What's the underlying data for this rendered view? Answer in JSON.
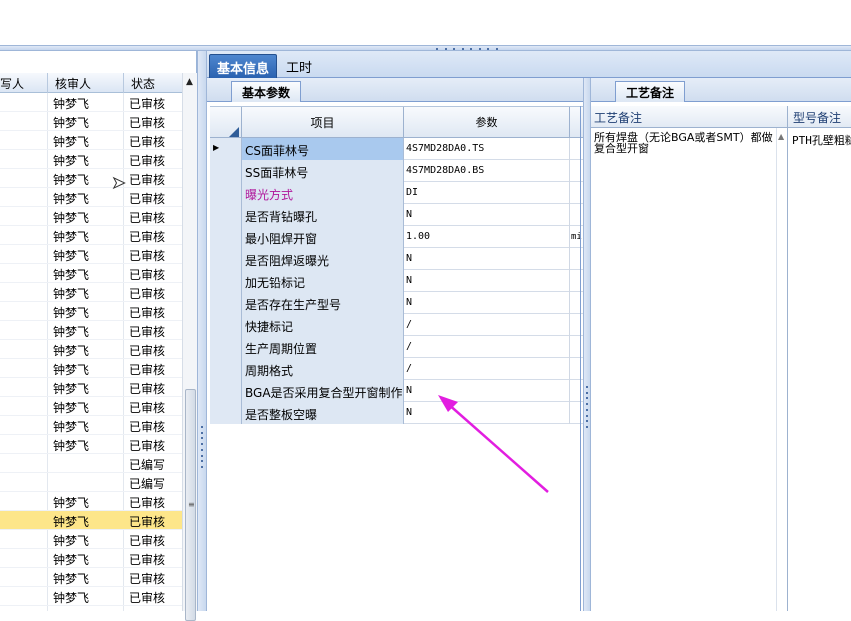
{
  "colors": {
    "accent": "#2a62b0",
    "selected_row": "#fde68a",
    "annotation_arrow": "#e21ee0"
  },
  "left_list": {
    "headers": [
      "写人",
      "核审人",
      "状态"
    ],
    "rows": [
      {
        "c0": "",
        "c1": "钟梦飞",
        "c2": "已审核"
      },
      {
        "c0": "",
        "c1": "钟梦飞",
        "c2": "已审核"
      },
      {
        "c0": "",
        "c1": "钟梦飞",
        "c2": "已审核"
      },
      {
        "c0": "",
        "c1": "钟梦飞",
        "c2": "已审核"
      },
      {
        "c0": "",
        "c1": "钟梦飞",
        "c2": "已审核"
      },
      {
        "c0": "",
        "c1": "钟梦飞",
        "c2": "已审核"
      },
      {
        "c0": "",
        "c1": "钟梦飞",
        "c2": "已审核"
      },
      {
        "c0": "",
        "c1": "钟梦飞",
        "c2": "已审核"
      },
      {
        "c0": "",
        "c1": "钟梦飞",
        "c2": "已审核"
      },
      {
        "c0": "",
        "c1": "钟梦飞",
        "c2": "已审核"
      },
      {
        "c0": "",
        "c1": "钟梦飞",
        "c2": "已审核"
      },
      {
        "c0": "",
        "c1": "钟梦飞",
        "c2": "已审核"
      },
      {
        "c0": "",
        "c1": "钟梦飞",
        "c2": "已审核"
      },
      {
        "c0": "",
        "c1": "钟梦飞",
        "c2": "已审核"
      },
      {
        "c0": "",
        "c1": "钟梦飞",
        "c2": "已审核"
      },
      {
        "c0": "",
        "c1": "钟梦飞",
        "c2": "已审核"
      },
      {
        "c0": "",
        "c1": "钟梦飞",
        "c2": "已审核"
      },
      {
        "c0": "",
        "c1": "钟梦飞",
        "c2": "已审核"
      },
      {
        "c0": "",
        "c1": "钟梦飞",
        "c2": "已审核"
      },
      {
        "c0": "",
        "c1": "",
        "c2": "已编写"
      },
      {
        "c0": "",
        "c1": "",
        "c2": "已编写"
      },
      {
        "c0": "",
        "c1": "钟梦飞",
        "c2": "已审核"
      },
      {
        "c0": "",
        "c1": "钟梦飞",
        "c2": "已审核"
      },
      {
        "c0": "",
        "c1": "钟梦飞",
        "c2": "已审核"
      },
      {
        "c0": "",
        "c1": "钟梦飞",
        "c2": "已审核"
      },
      {
        "c0": "",
        "c1": "钟梦飞",
        "c2": "已审核"
      },
      {
        "c0": "",
        "c1": "钟梦飞",
        "c2": "已审核"
      }
    ],
    "selected_index": 22
  },
  "main_tabs": [
    {
      "label": "基本信息"
    },
    {
      "label": "工时"
    }
  ],
  "params": {
    "tab_label": "基本参数",
    "col_item": "项目",
    "col_value": "参数",
    "rows": [
      {
        "name": "CS面菲林号",
        "value": "4S7MD28DA0.TS",
        "extra": ""
      },
      {
        "name": "SS面菲林号",
        "value": "4S7MD28DA0.BS",
        "extra": ""
      },
      {
        "name": "曝光方式",
        "value": "DI",
        "extra": ""
      },
      {
        "name": "是否背钻曝孔",
        "value": "N",
        "extra": ""
      },
      {
        "name": "最小阻焊开窗",
        "value": "1.00",
        "extra": "mi"
      },
      {
        "name": "是否阻焊返曝光",
        "value": "N",
        "extra": ""
      },
      {
        "name": "加无铅标记",
        "value": "N",
        "extra": ""
      },
      {
        "name": "是否存在生产型号",
        "value": "N",
        "extra": ""
      },
      {
        "name": "快捷标记",
        "value": "/",
        "extra": ""
      },
      {
        "name": "生产周期位置",
        "value": "/",
        "extra": ""
      },
      {
        "name": "周期格式",
        "value": "/",
        "extra": ""
      },
      {
        "name": "BGA是否采用复合型开窗制作",
        "value": "N",
        "extra": ""
      },
      {
        "name": "是否整板空曝",
        "value": "N",
        "extra": ""
      }
    ]
  },
  "remarks": {
    "tab_label": "工艺备注",
    "col1": "工艺备注",
    "col2": "型号备注",
    "text1": "所有焊盘（无论BGA或者SMT）都做复合型开窗",
    "text2": "PTH孔壁粗糙"
  }
}
